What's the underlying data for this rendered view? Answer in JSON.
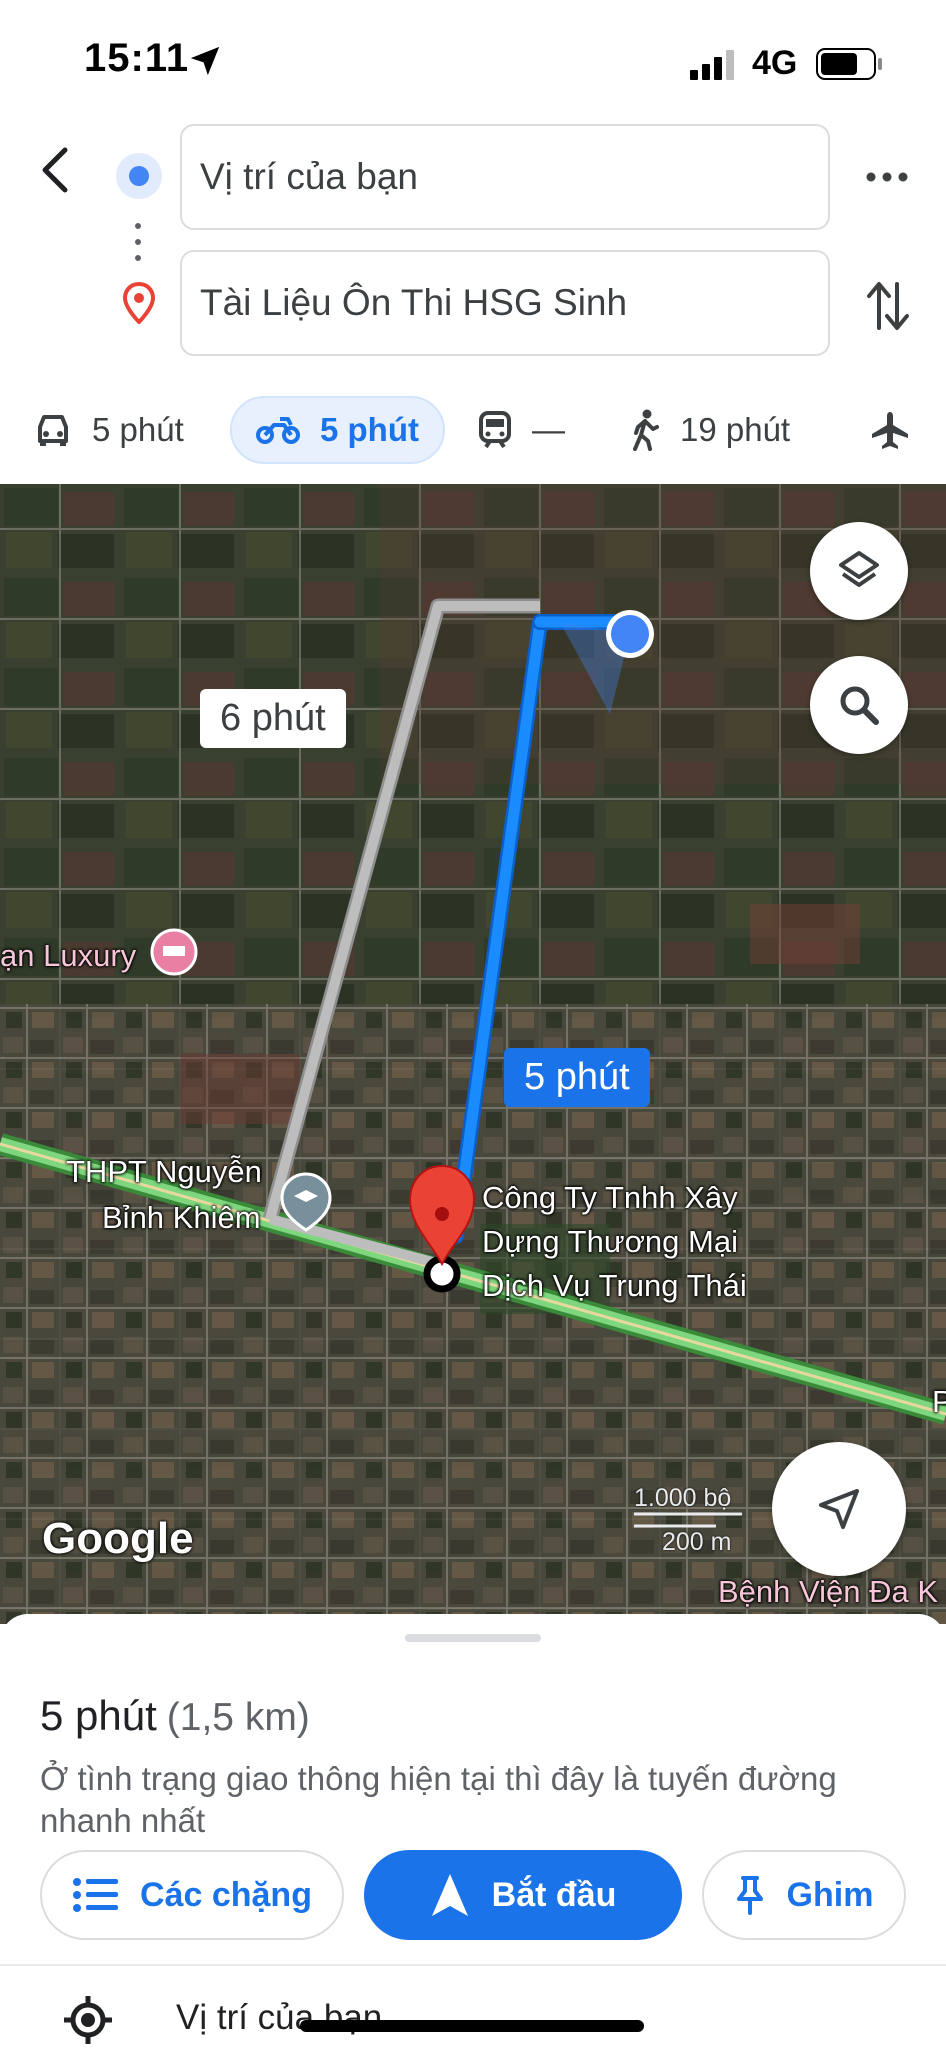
{
  "status_bar": {
    "time": "15:11",
    "network": "4G",
    "icons": [
      "location-arrow-icon",
      "signal-icon",
      "battery-icon"
    ]
  },
  "directions": {
    "origin": "Vị trí của bạn",
    "destination": "Tài Liệu Ôn Thi HSG Sinh"
  },
  "travel_modes": {
    "car": "5 phút",
    "motorbike": "5 phút",
    "transit": "—",
    "walk": "19 phút",
    "selected": "motorbike"
  },
  "map": {
    "alt_route_time": "6 phút",
    "main_route_time": "5 phút",
    "labels": {
      "hotel": "ạn Luxury",
      "school_line1": "THPT Nguyễn",
      "school_line2": "Bỉnh Khiêm",
      "dest_line1": "Công Ty Tnhh Xây",
      "dest_line2": "Dựng Thương Mại",
      "dest_line3": "Dịch Vụ Trung Thái",
      "hospital": "Bệnh Viện Đa K",
      "road_edge": "P"
    },
    "attribution": "Google",
    "scale_ft": "1.000 bộ",
    "scale_m": "200 m",
    "colors": {
      "main_route": "#1a8cff",
      "alt_route": "#bdbdbd",
      "highway": "#7ed67e",
      "pin": "#ea4335",
      "origin_dot": "#4285f4"
    }
  },
  "sheet": {
    "duration": "5 phút",
    "distance": "(1,5 km)",
    "description": "Ở tình trạng giao thông hiện tại thì đây là tuyến đường nhanh nhất",
    "buttons": {
      "steps": "Các chặng",
      "start": "Bắt đầu",
      "pin": "Ghim"
    },
    "first_step": "Vị trí của bạn"
  }
}
